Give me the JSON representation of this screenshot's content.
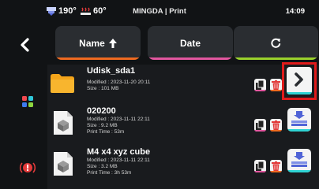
{
  "status_bar": {
    "nozzle_temp": "190°",
    "bed_temp": "60°",
    "title": "MINGDA  |  Print",
    "time": "14:09",
    "nozzle_icon": "nozzle-icon",
    "bed_icon": "heated-bed-icon"
  },
  "sort_bar": {
    "name_label": "Name",
    "name_icon": "arrow-up-icon",
    "date_label": "Date",
    "refresh_icon": "refresh-icon",
    "colors": {
      "name": "#ef6a20",
      "date": "#e2569f",
      "refresh": "#9ad12c"
    }
  },
  "files": [
    {
      "name": "Udisk_sda1",
      "type": "folder",
      "modified": "Modified : 2023-11-20 20:11",
      "size": "Size : 101 MB",
      "print_time": ""
    },
    {
      "name": "020200",
      "type": "model",
      "modified": "Modified : 2023-11-11 22:11",
      "size": "Size : 9.2 MB",
      "print_time": "Print Time : 53m"
    },
    {
      "name": "M4 x4 xyz cube",
      "type": "model",
      "modified": "Modified : 2023-11-11 22:11",
      "size": "Size : 3.2 MB",
      "print_time": "Print Time : 3h 53m"
    }
  ],
  "colors": {
    "accent_cyan": "#2ed3d3",
    "copy_underline": "#e2569f",
    "delete_underline": "#ef6a20",
    "highlight": "#e01b1b",
    "folder": "#f5a51a"
  }
}
